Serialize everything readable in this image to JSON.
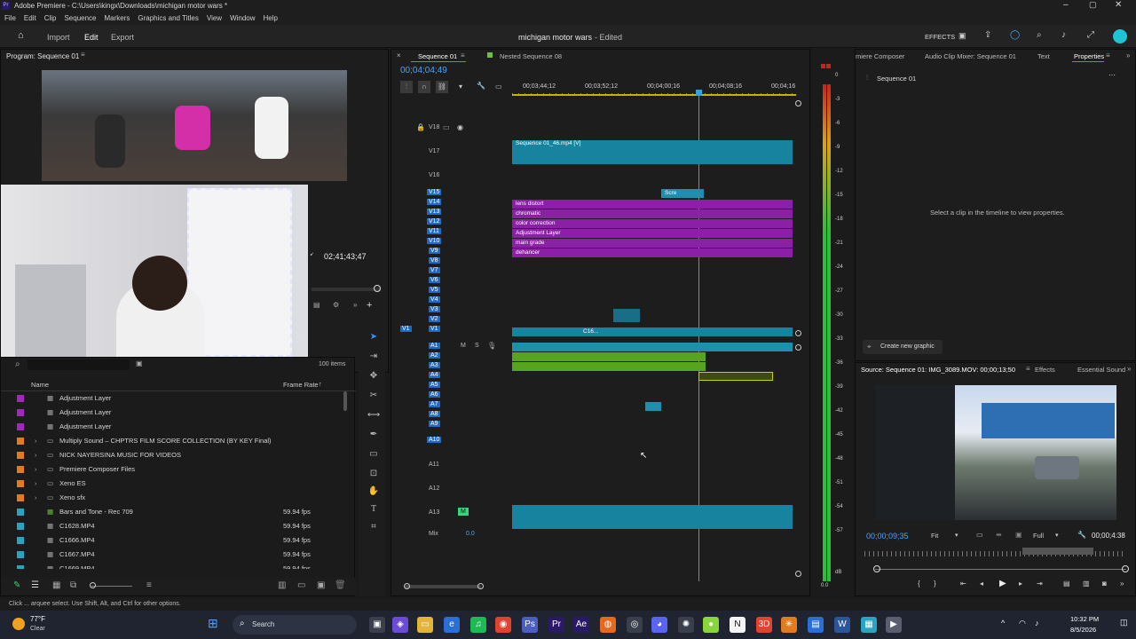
{
  "app": {
    "title": "Adobe Premiere - C:\\Users\\kingx\\Downloads\\michigan motor wars *",
    "menu": [
      "File",
      "Edit",
      "Clip",
      "Sequence",
      "Markers",
      "Graphics and Titles",
      "View",
      "Window",
      "Help"
    ]
  },
  "header": {
    "home": "Home",
    "tabs": [
      "Import",
      "Edit",
      "Export"
    ],
    "active_tab": "Edit",
    "project": "michigan motor wars",
    "status": "- Edited",
    "effects": "EFFECTS"
  },
  "program": {
    "title": "Program: Sequence 01",
    "timecode": "02;41;43;47"
  },
  "project": {
    "item_count": "100 items",
    "col_name": "Name",
    "col_rate": "Frame Rate",
    "rows": [
      {
        "name": "Adjustment Layer",
        "rate": "",
        "color": "#a02ab7",
        "folder": false
      },
      {
        "name": "Adjustment Layer",
        "rate": "",
        "color": "#a02ab7",
        "folder": false
      },
      {
        "name": "Adjustment Layer",
        "rate": "",
        "color": "#a02ab7",
        "folder": false
      },
      {
        "name": "Multiply Sound – CHPTRS FILM SCORE COLLECTION (BY KEY Final)",
        "rate": "",
        "color": "#e07b1e",
        "folder": true
      },
      {
        "name": "NICK NAYERSINA MUSIC FOR VIDEOS",
        "rate": "",
        "color": "#e07b1e",
        "folder": true
      },
      {
        "name": "Premiere Composer Files",
        "rate": "",
        "color": "#e07b1e",
        "folder": true
      },
      {
        "name": "Xeno ES",
        "rate": "",
        "color": "#e07b1e",
        "folder": true
      },
      {
        "name": "Xeno sfx",
        "rate": "",
        "color": "#e07b1e",
        "folder": true
      },
      {
        "name": "Bars and Tone - Rec 709",
        "rate": "59.94 fps",
        "color": "#2ba4c2",
        "folder": false
      },
      {
        "name": "C1628.MP4",
        "rate": "59.94 fps",
        "color": "#2ba4c2",
        "folder": false
      },
      {
        "name": "C1666.MP4",
        "rate": "59.94 fps",
        "color": "#2ba4c2",
        "folder": false
      },
      {
        "name": "C1667.MP4",
        "rate": "59.94 fps",
        "color": "#2ba4c2",
        "folder": false
      },
      {
        "name": "C1669.MP4",
        "rate": "59.94 fps",
        "color": "#2ba4c2",
        "folder": false
      }
    ]
  },
  "timeline": {
    "tabs": [
      "Sequence 01",
      "Nested Sequence 08"
    ],
    "timecode": "00;04;04;49",
    "ruler": [
      "00;03;44;12",
      "00;03;52;12",
      "00;04;00;16",
      "00;04;08;16",
      "00;04;16"
    ],
    "video_tracks": [
      "V18",
      "V17",
      "V16",
      "V15",
      "V14",
      "V13",
      "V12",
      "V11",
      "V10",
      "V9",
      "V8",
      "V7",
      "V6",
      "V5",
      "V4",
      "V3",
      "V2",
      "V1"
    ],
    "audio_tracks": [
      "A1",
      "A2",
      "A3",
      "A4",
      "A5",
      "A6",
      "A7",
      "A8",
      "A9",
      "A10",
      "A11",
      "A12",
      "A13"
    ],
    "mix": "Mix",
    "mix_value": "0.0",
    "clips": {
      "seq": "Sequence 01_46.mp4 [V]",
      "scr": "Scre",
      "fx": "fx",
      "c16": "C16...",
      "purple": [
        "lens distort",
        "chromatic",
        "color correction",
        "Adjustment Layer",
        "main grade",
        "dehancer"
      ]
    },
    "track_btns": {
      "m": "M",
      "s": "S"
    }
  },
  "meter": {
    "scale": [
      "0",
      "-3",
      "-6",
      "-9",
      "-12",
      "-15",
      "-18",
      "-21",
      "-24",
      "-27",
      "-30",
      "-33",
      "-36",
      "-39",
      "-42",
      "-45",
      "-48",
      "-51",
      "-54",
      "-57",
      "dB"
    ],
    "bottom": "0.0"
  },
  "right_panel": {
    "tabs": [
      "miere Composer",
      "Audio Clip Mixer: Sequence 01",
      "Text",
      "Properties"
    ],
    "seq": "Sequence 01",
    "message": "Select a clip in the timeline to view properties.",
    "new_graphic": "Create new graphic"
  },
  "source": {
    "title": "Source: Sequence 01: IMG_3089.MOV: 00;00;13;50",
    "tabs": [
      "Effects",
      "Essential Sound"
    ],
    "timecode": "00;00;09;35",
    "fit": "Fit",
    "quality": "Full",
    "end_tc": "00;00;4:38"
  },
  "status": {
    "text": "Click ... arquee select. Use Shift, Alt, and Ctrl for other options."
  },
  "taskbar": {
    "weather_temp": "77°F",
    "weather_cond": "Clear",
    "search": "Search",
    "time": "10:32 PM",
    "date": "8/5/2026"
  }
}
